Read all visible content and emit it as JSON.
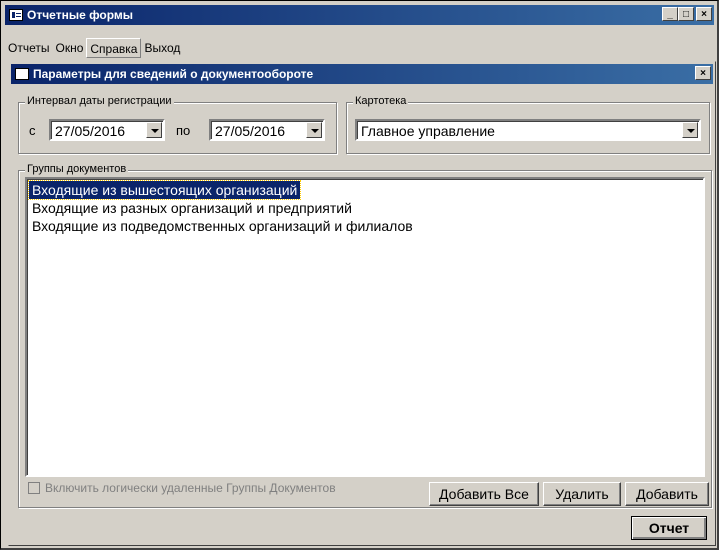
{
  "app": {
    "title": "Отчетные формы",
    "title_buttons": [
      "_",
      "□",
      "×"
    ]
  },
  "menu": {
    "items": [
      "Отчеты",
      "Окно",
      "Справка",
      "Выход"
    ]
  },
  "dialog": {
    "title": "Параметры для сведений о документообороте",
    "close": "×",
    "date_interval": {
      "legend": "Интервал даты регистрации",
      "from_label": "с",
      "from_value": "27/05/2016",
      "to_label": "по",
      "to_value": "27/05/2016"
    },
    "card_index": {
      "legend": "Картотека",
      "value": "Главное управление"
    },
    "doc_groups": {
      "legend": "Группы документов",
      "items": [
        "Входящие из вышестоящих организаций",
        "Входящие из разных организаций и предприятий",
        "Входящие из подведомственных организаций и филиалов"
      ],
      "selected_index": 0
    },
    "include_deleted_label": "Включить логически удаленные Группы Документов",
    "buttons": {
      "add_all": "Добавить Все",
      "delete": "Удалить",
      "add": "Добавить",
      "report": "Отчет"
    }
  },
  "icons": {
    "window": "form-window-icon",
    "dropdown": "chevron-down-icon"
  },
  "colors": {
    "titlebar_start": "#0a246a",
    "titlebar_end": "#3a6ea5",
    "face": "#d4d0c8",
    "selection": "#0a246a"
  }
}
